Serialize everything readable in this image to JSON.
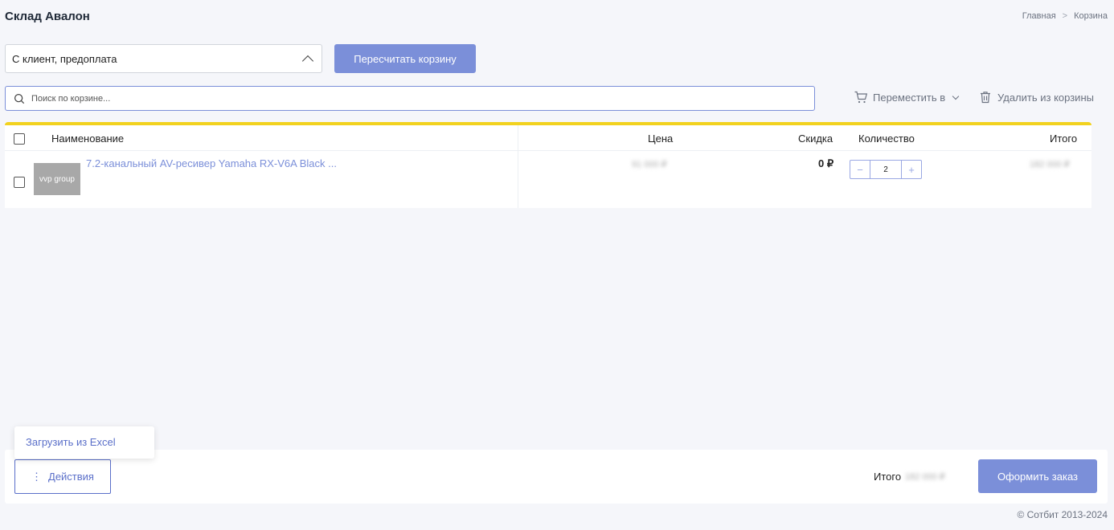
{
  "header": {
    "title": "Склад Авалон",
    "breadcrumb": {
      "home": "Главная",
      "current": "Корзина"
    }
  },
  "controls": {
    "order_type": "С клиент, предоплата",
    "recalc_label": "Пересчитать корзину",
    "search_placeholder": "Поиск по корзине...",
    "move_label": "Переместить в",
    "delete_label": "Удалить из корзины"
  },
  "table": {
    "columns": {
      "name": "Наименование",
      "price": "Цена",
      "discount": "Скидка",
      "quantity": "Количество",
      "total": "Итого"
    },
    "rows": [
      {
        "thumb_text": "vvp group",
        "name": "7.2-канальный AV-ресивер Yamaha RX-V6A Black ...",
        "price": "91 000 ₽",
        "discount": "0 ₽",
        "quantity": "2",
        "total": "182 000 ₽"
      }
    ]
  },
  "actions_menu": {
    "excel_label": "Загрузить из Excel"
  },
  "footer": {
    "actions_label": "Действия",
    "total_label": "Итого",
    "total_value": "182 000 ₽",
    "order_label": "Оформить заказ",
    "copyright": "© Сотбит 2013-2024"
  },
  "colors": {
    "accent": "#7b8fd9",
    "highlight": "#f2d21e"
  }
}
